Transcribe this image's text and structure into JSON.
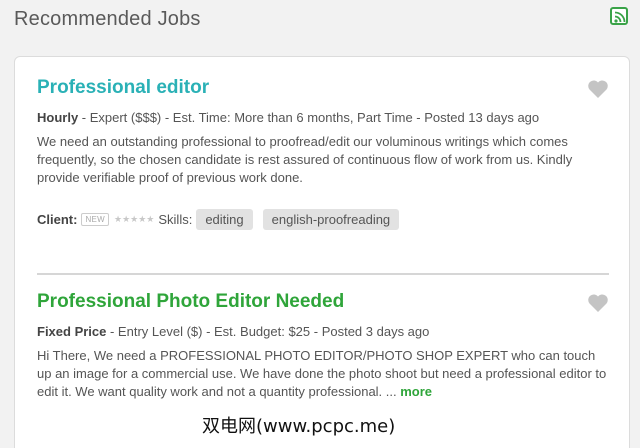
{
  "header": {
    "title": "Recommended Jobs",
    "rss_icon": "rss-icon"
  },
  "jobs": [
    {
      "title": "Professional editor",
      "meta_type": "Hourly",
      "meta_rest": " - Expert ($$$) - Est. Time: More than 6 months, Part Time - Posted 13 days ago",
      "description": "We need an outstanding professional to proofread/edit our voluminous writings which comes frequently, so the chosen candidate is rest assured of continuous flow of work from us. Kindly provide verifiable proof of previous work done.",
      "client_label": "Client:",
      "client_badge": "NEW",
      "rating_stars": "★★★★★",
      "skills_label": "Skills:",
      "skills": [
        "editing",
        "english-proofreading"
      ]
    },
    {
      "title": "Professional Photo Editor Needed",
      "meta_type": "Fixed Price",
      "meta_rest": " - Entry Level ($) - Est. Budget: $25 - Posted 3 days ago",
      "description": "Hi There, We need a PROFESSIONAL PHOTO EDITOR/PHOTO SHOP EXPERT who can touch up an image for a commercial use. We have done the photo shoot but need a professional editor to edit it. We want quality work and not a quantity professional. ...",
      "more_label": "more"
    }
  ],
  "watermark": "双电网(www.pcpc.me)",
  "colors": {
    "teal_title": "#2ab1b6",
    "green_title": "#2fa53a",
    "rss_green": "#3aa348"
  }
}
